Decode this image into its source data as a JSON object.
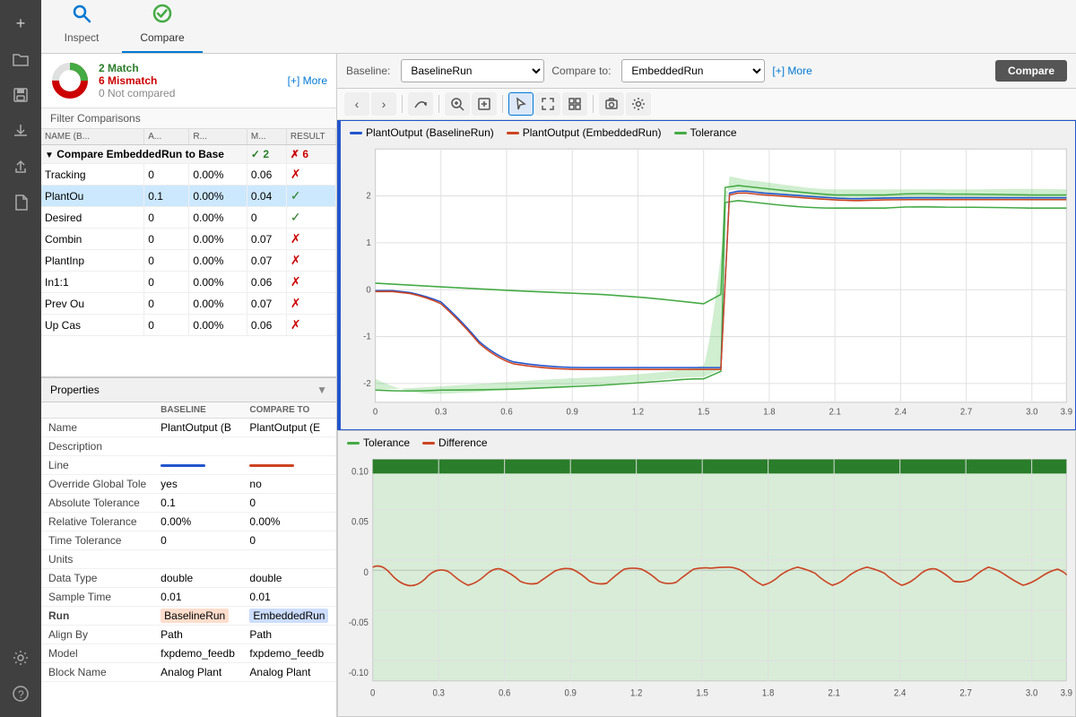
{
  "sidebar": {
    "icons": [
      {
        "name": "plus-icon",
        "symbol": "+",
        "label": "Add"
      },
      {
        "name": "folder-icon",
        "symbol": "🗁",
        "label": "Open"
      },
      {
        "name": "save-icon",
        "symbol": "💾",
        "label": "Save"
      },
      {
        "name": "download-icon",
        "symbol": "⬇",
        "label": "Download"
      },
      {
        "name": "share-icon",
        "symbol": "↑",
        "label": "Share"
      },
      {
        "name": "document-icon",
        "symbol": "📄",
        "label": "Document"
      },
      {
        "name": "gear-icon",
        "symbol": "⚙",
        "label": "Settings"
      },
      {
        "name": "question-icon",
        "symbol": "?",
        "label": "Help"
      }
    ]
  },
  "tabs": [
    {
      "id": "inspect",
      "label": "Inspect",
      "icon": "🔍",
      "active": false
    },
    {
      "id": "compare",
      "label": "Compare",
      "icon": "✓",
      "active": true
    }
  ],
  "summary": {
    "match_count": "2 Match",
    "mismatch_count": "6 Mismatch",
    "notcompared": "0 Not compared",
    "more_label": "[+] More"
  },
  "filter": {
    "label": "Filter Comparisons"
  },
  "table": {
    "headers": [
      "NAME (B...",
      "A...",
      "R...",
      "M...",
      "RESULT"
    ],
    "group_row": {
      "label": "Compare EmbeddedRun to Base",
      "match": "2",
      "mismatch": "6"
    },
    "rows": [
      {
        "name": "Tracking",
        "a": "0",
        "r": "0.00%",
        "m": "0.06",
        "result": "x",
        "selected": false
      },
      {
        "name": "PlantOu",
        "a": "0.1",
        "r": "0.00%",
        "m": "0.04",
        "result": "check",
        "selected": true
      },
      {
        "name": "Desired",
        "a": "0",
        "r": "0.00%",
        "m": "0",
        "result": "check",
        "selected": false
      },
      {
        "name": "Combin",
        "a": "0",
        "r": "0.00%",
        "m": "0.07",
        "result": "x",
        "selected": false
      },
      {
        "name": "PlantInp",
        "a": "0",
        "r": "0.00%",
        "m": "0.07",
        "result": "x",
        "selected": false
      },
      {
        "name": "In1:1",
        "a": "0",
        "r": "0.00%",
        "m": "0.06",
        "result": "x",
        "selected": false
      },
      {
        "name": "Prev Ou",
        "a": "0",
        "r": "0.00%",
        "m": "0.07",
        "result": "x",
        "selected": false
      },
      {
        "name": "Up Cas",
        "a": "0",
        "r": "0.00%",
        "m": "0.06",
        "result": "x",
        "selected": false
      }
    ]
  },
  "properties": {
    "title": "Properties",
    "columns": {
      "baseline": "BASELINE",
      "compare_to": "COMPARE TO"
    },
    "rows": [
      {
        "label": "Name",
        "baseline": "PlantOutput (B",
        "compare": "PlantOutput (E"
      },
      {
        "label": "Description",
        "baseline": "",
        "compare": ""
      },
      {
        "label": "Line",
        "baseline": "blue-line",
        "compare": "orange-line"
      },
      {
        "label": "Override Global Tole",
        "baseline": "yes",
        "compare": "no"
      },
      {
        "label": "Absolute Tolerance",
        "baseline": "0.1",
        "compare": "0"
      },
      {
        "label": "Relative Tolerance",
        "baseline": "0.00%",
        "compare": "0.00%"
      },
      {
        "label": "Time Tolerance",
        "baseline": "0",
        "compare": "0"
      },
      {
        "label": "Units",
        "baseline": "",
        "compare": ""
      },
      {
        "label": "Data Type",
        "baseline": "double",
        "compare": "double"
      },
      {
        "label": "Sample Time",
        "baseline": "0.01",
        "compare": "0.01"
      },
      {
        "label": "Run",
        "baseline": "BaselineRun",
        "compare": "EmbeddedRun"
      },
      {
        "label": "Align By",
        "baseline": "Path",
        "compare": "Path"
      },
      {
        "label": "Model",
        "baseline": "fxpdemo_feedb",
        "compare": "fxpdemo_feedb"
      },
      {
        "label": "Block Name",
        "baseline": "Analog Plant",
        "compare": "Analog Plant"
      }
    ]
  },
  "toolbar": {
    "baseline_label": "Baseline:",
    "baseline_value": "BaselineRun",
    "compare_label": "Compare to:",
    "compare_value": "EmbeddedRun",
    "more_label": "[+] More",
    "compare_button": "Compare"
  },
  "chart_top": {
    "legend": [
      {
        "label": "PlantOutput (BaselineRun)",
        "color": "#2255cc"
      },
      {
        "label": "PlantOutput (EmbeddedRun)",
        "color": "#cc4422"
      },
      {
        "label": "Tolerance",
        "color": "#44aa44"
      }
    ]
  },
  "chart_bottom": {
    "legend": [
      {
        "label": "Tolerance",
        "color": "#44aa44"
      },
      {
        "label": "Difference",
        "color": "#cc4422"
      }
    ]
  }
}
